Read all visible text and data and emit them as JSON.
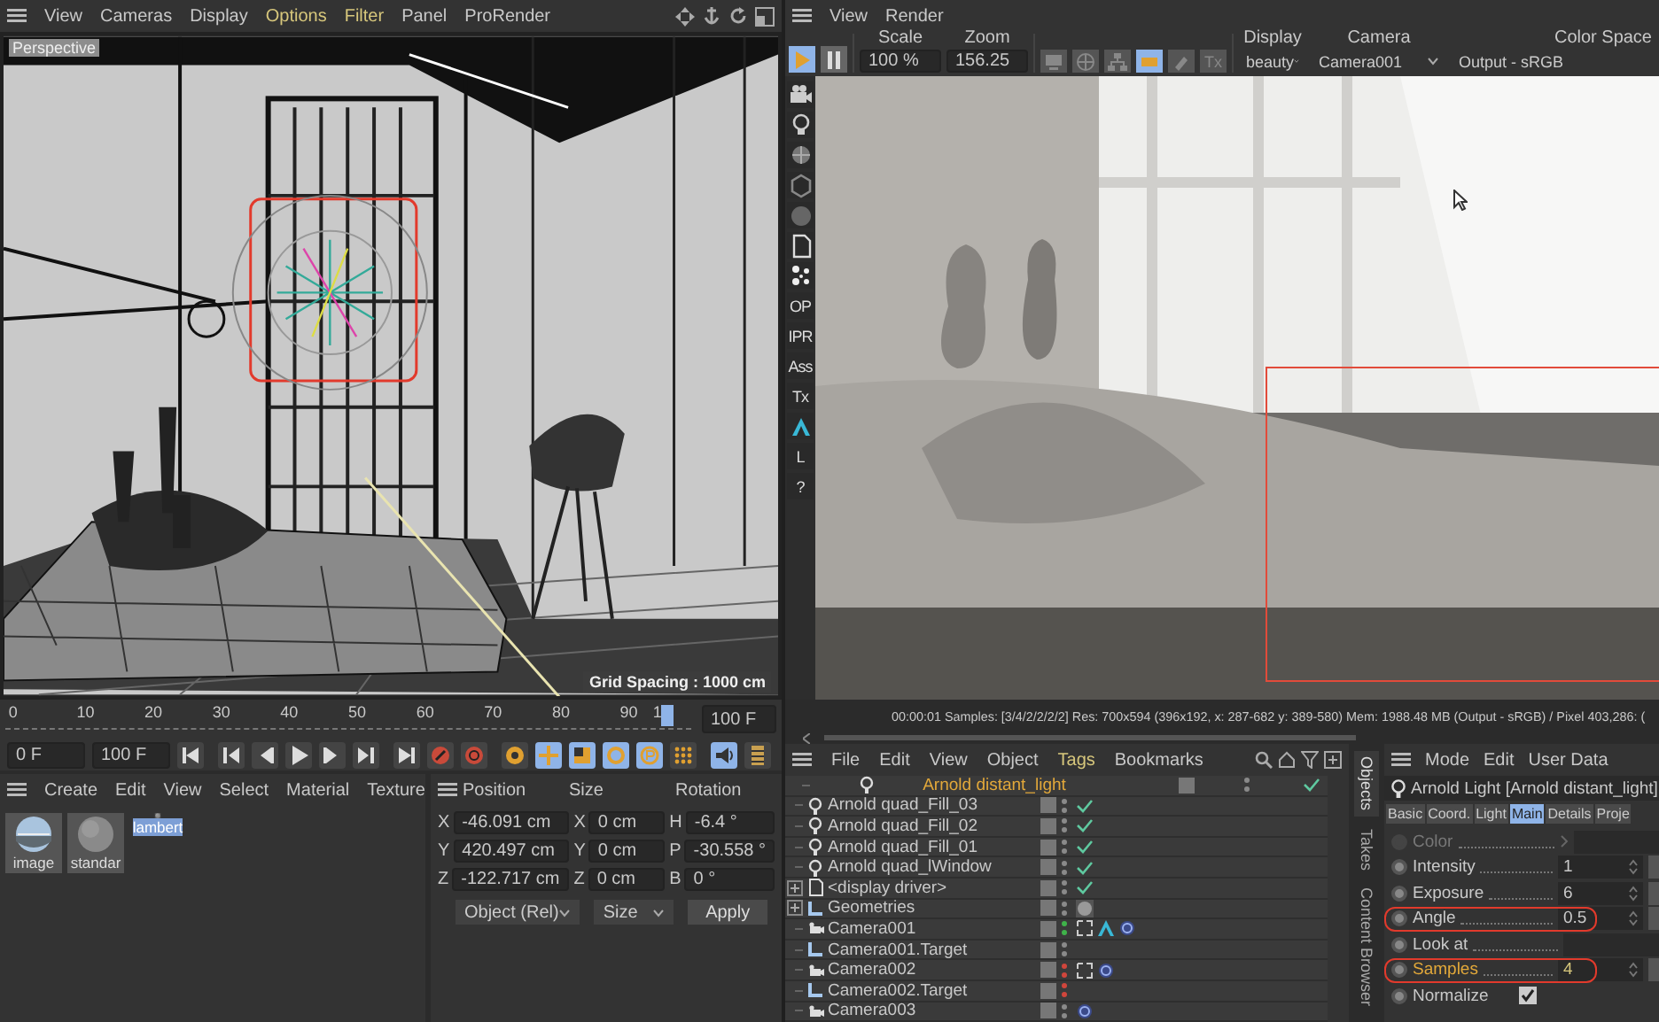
{
  "viewport_menu": [
    {
      "label": "View",
      "highlighted": false
    },
    {
      "label": "Cameras",
      "highlighted": false
    },
    {
      "label": "Display",
      "highlighted": false
    },
    {
      "label": "Options",
      "highlighted": true
    },
    {
      "label": "Filter",
      "highlighted": true
    },
    {
      "label": "Panel",
      "highlighted": false
    },
    {
      "label": "ProRender",
      "highlighted": false
    }
  ],
  "viewport": {
    "camera_label": "Perspective",
    "grid_spacing": "Grid Spacing : 1000 cm"
  },
  "timeline": {
    "ticks": [
      "0",
      "10",
      "20",
      "30",
      "40",
      "50",
      "60",
      "70",
      "80",
      "90"
    ],
    "marker_label": "1",
    "end_field": "100 F"
  },
  "transport": {
    "start": "0 F",
    "end": "100 F"
  },
  "anim_tools": [
    {
      "selected": false
    },
    {
      "selected": false
    },
    {
      "selected": false
    },
    {
      "selected": true
    },
    {
      "selected": true
    },
    {
      "selected": true
    },
    {
      "selected": true
    },
    {
      "selected": false
    },
    {
      "selected": true
    },
    {
      "selected": false
    }
  ],
  "materials": {
    "menu": [
      "Create",
      "Edit",
      "View",
      "Select",
      "Material",
      "Texture"
    ],
    "items": [
      {
        "name": "image",
        "kind": "environment",
        "selected": false
      },
      {
        "name": "standar",
        "kind": "sphere",
        "selected": false
      },
      {
        "name": "lambert",
        "kind": "sphere",
        "selected": true
      }
    ]
  },
  "coordinates": {
    "headers": [
      "Position",
      "Size",
      "Rotation"
    ],
    "rows": [
      [
        {
          "axis": "X",
          "value": "-46.091 cm"
        },
        {
          "axis": "X",
          "value": "0 cm"
        },
        {
          "axis": "H",
          "value": "-6.4 °"
        }
      ],
      [
        {
          "axis": "Y",
          "value": "420.497 cm"
        },
        {
          "axis": "Y",
          "value": "0 cm"
        },
        {
          "axis": "P",
          "value": "-30.558 °"
        }
      ],
      [
        {
          "axis": "Z",
          "value": "-122.717 cm"
        },
        {
          "axis": "Z",
          "value": "0 cm"
        },
        {
          "axis": "B",
          "value": "0 °"
        }
      ]
    ],
    "dropdowns": [
      "Object (Rel)",
      "Size"
    ],
    "apply": "Apply"
  },
  "render_menu": [
    "View",
    "Render"
  ],
  "render_toolbar": {
    "playing": true,
    "scale_label": "Scale",
    "scale": "100 %",
    "zoom_label": "Zoom",
    "zoom": "156.25",
    "view_tools": [
      {
        "selected": false
      },
      {
        "selected": false
      },
      {
        "selected": false
      },
      {
        "selected": true
      },
      {
        "selected": false
      },
      {
        "label": "Tx",
        "selected": false
      }
    ],
    "display_label": "Display",
    "display": "beauty",
    "camera_label": "Camera",
    "camera": "Camera001",
    "color_space_label": "Color Space",
    "color_space": "Output - sRGB"
  },
  "tool_strip": [
    "OP",
    "IPR",
    "Ass",
    "Tx",
    "L",
    "?"
  ],
  "status": "00:00:01 Samples: [3/4/2/2/2/2] Res: 700x594 (396x192, x: 287-682 y: 389-580) Mem: 1988.48 MB (Output - sRGB) / Pixel 403,286: (",
  "objects": {
    "menu": [
      {
        "label": "File",
        "highlighted": false
      },
      {
        "label": "Edit",
        "highlighted": false
      },
      {
        "label": "View",
        "highlighted": false
      },
      {
        "label": "Object",
        "highlighted": false
      },
      {
        "label": "Tags",
        "highlighted": true
      },
      {
        "label": "Bookmarks",
        "highlighted": false
      }
    ],
    "rows": [
      {
        "name": "Arnold distant_light",
        "kind": "light",
        "selected": true,
        "expandable": false,
        "color": "#8a8a8a",
        "tags": [
          {
            "kind": "check"
          }
        ]
      },
      {
        "name": "Arnold quad_Fill_03",
        "kind": "light",
        "selected": false,
        "expandable": false,
        "color": "#8a8a8a",
        "tags": [
          {
            "kind": "check"
          }
        ]
      },
      {
        "name": "Arnold quad_Fill_02",
        "kind": "light",
        "selected": false,
        "expandable": false,
        "color": "#8a8a8a",
        "tags": [
          {
            "kind": "check"
          }
        ]
      },
      {
        "name": "Arnold quad_Fill_01",
        "kind": "light",
        "selected": false,
        "expandable": false,
        "color": "#8a8a8a",
        "tags": [
          {
            "kind": "check"
          }
        ]
      },
      {
        "name": "Arnold quad_lWindow",
        "kind": "light",
        "selected": false,
        "expandable": false,
        "color": "#8a8a8a",
        "tags": [
          {
            "kind": "check"
          }
        ]
      },
      {
        "name": "<display driver>",
        "kind": "page",
        "selected": false,
        "expandable": true,
        "color": "#8a8a8a",
        "tags": [
          {
            "kind": "check"
          }
        ]
      },
      {
        "name": "Geometries",
        "kind": "null",
        "selected": false,
        "expandable": true,
        "color": "#8a8a8a",
        "tags": [
          {
            "kind": "sphere"
          }
        ]
      },
      {
        "name": "Camera001",
        "kind": "camera",
        "selected": false,
        "expandable": false,
        "color": "#3fb24a",
        "tags": [
          {
            "kind": "crop"
          },
          {
            "kind": "arnold"
          },
          {
            "kind": "circle"
          }
        ]
      },
      {
        "name": "Camera001.Target",
        "kind": "null",
        "selected": false,
        "expandable": false,
        "color": "#8a8a8a",
        "tags": []
      },
      {
        "name": "Camera002",
        "kind": "camera",
        "selected": false,
        "expandable": false,
        "color": "#d0463c",
        "tags": [
          {
            "kind": "crop"
          },
          {
            "kind": "circle"
          }
        ]
      },
      {
        "name": "Camera002.Target",
        "kind": "null",
        "selected": false,
        "expandable": false,
        "color": "#d0463c",
        "tags": []
      },
      {
        "name": "Camera003",
        "kind": "camera",
        "selected": false,
        "expandable": false,
        "color": "#8a8a8a",
        "tags": [
          {
            "kind": "circle"
          }
        ]
      }
    ]
  },
  "side_tabs": [
    {
      "label": "Objects",
      "selected": true
    },
    {
      "label": "Takes",
      "selected": false
    },
    {
      "label": "Content Browser",
      "selected": false
    }
  ],
  "attributes": {
    "menu": [
      "Mode",
      "Edit",
      "User Data"
    ],
    "title": "Arnold Light [Arnold distant_light]",
    "tabs": [
      {
        "label": "Basic",
        "selected": false
      },
      {
        "label": "Coord.",
        "selected": false
      },
      {
        "label": "Light",
        "selected": false
      },
      {
        "label": "Main",
        "selected": true
      },
      {
        "label": "Details",
        "selected": false
      },
      {
        "label": "Proje",
        "selected": false
      }
    ],
    "params": [
      {
        "label": "Color",
        "kind": "color",
        "disabled": true,
        "highlighted": false
      },
      {
        "label": "Intensity",
        "kind": "number",
        "value": "1",
        "disabled": false,
        "highlighted": false
      },
      {
        "label": "Exposure",
        "kind": "number",
        "value": "6",
        "disabled": false,
        "highlighted": false
      },
      {
        "label": "Angle",
        "kind": "number",
        "value": "0.5",
        "disabled": false,
        "highlighted": false,
        "circled": true
      },
      {
        "label": "Look at",
        "kind": "link",
        "disabled": false,
        "highlighted": false
      },
      {
        "label": "Samples",
        "kind": "number",
        "value": "4",
        "disabled": false,
        "highlighted": true,
        "circled": true
      },
      {
        "label": "Normalize",
        "kind": "checkbox",
        "checked": true,
        "disabled": false,
        "highlighted": false
      }
    ]
  }
}
